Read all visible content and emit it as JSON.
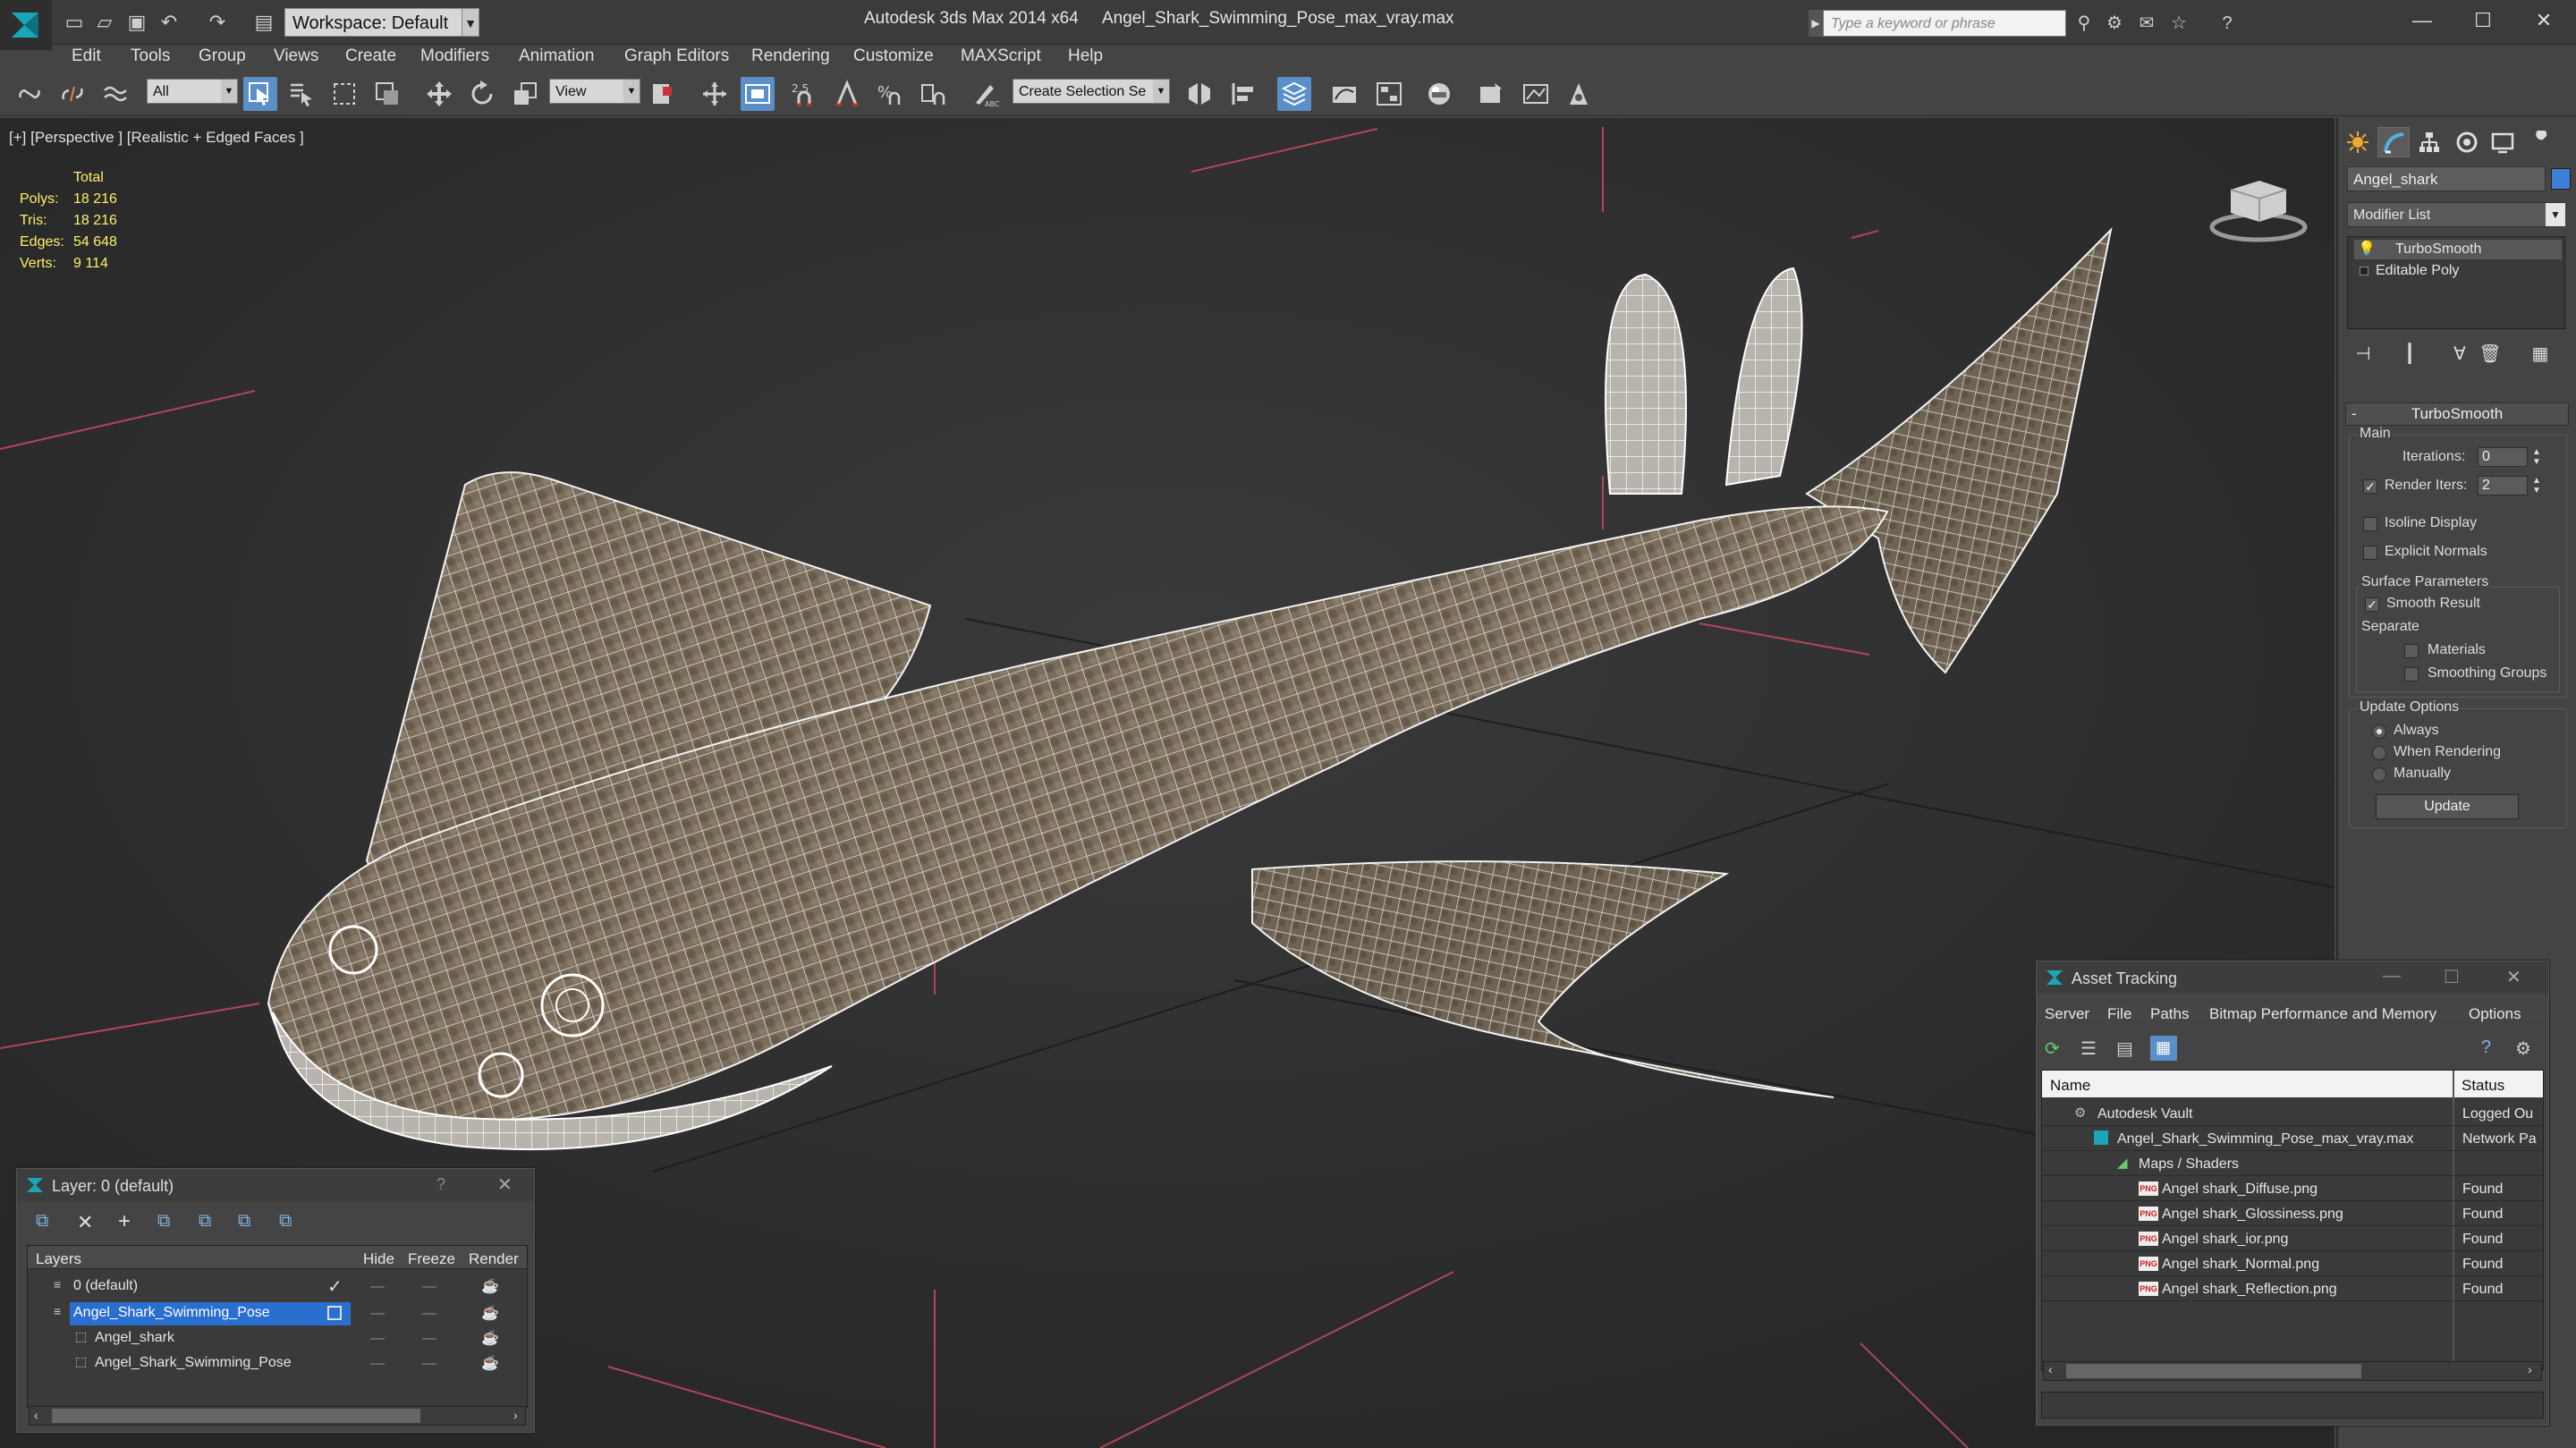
{
  "window": {
    "app_title": "Autodesk 3ds Max  2014 x64",
    "file_title": "Angel_Shark_Swimming_Pose_max_vray.max",
    "workspace": "Workspace: Default",
    "search_placeholder": "Type a keyword or phrase"
  },
  "menu": [
    "Edit",
    "Tools",
    "Group",
    "Views",
    "Create",
    "Modifiers",
    "Animation",
    "Graph Editors",
    "Rendering",
    "Customize",
    "MAXScript",
    "Help"
  ],
  "toolbar": {
    "selection_filter": "All",
    "ref_coord": "View",
    "snap_value": "2.5",
    "named_selection": "Create Selection Se"
  },
  "viewport": {
    "label": "[+] [Perspective ] [Realistic + Edged Faces ]",
    "stats_header": "Total",
    "stats": [
      {
        "label": "Polys:",
        "value": "18 216"
      },
      {
        "label": "Tris:",
        "value": "18 216"
      },
      {
        "label": "Edges:",
        "value": "54 648"
      },
      {
        "label": "Verts:",
        "value": "9 114"
      }
    ]
  },
  "command_panel": {
    "object_name": "Angel_shark",
    "object_color": "#3f7ed6",
    "modifier_list": "Modifier List",
    "stack": [
      "TurboSmooth",
      "Editable Poly"
    ],
    "rollout": "TurboSmooth",
    "main_label": "Main",
    "iterations_label": "Iterations:",
    "iterations_value": "0",
    "render_iters_label": "Render Iters:",
    "render_iters_value": "2",
    "isoline": "Isoline Display",
    "explicit_normals": "Explicit Normals",
    "surface_params": "Surface Parameters",
    "smooth_result": "Smooth Result",
    "separate": "Separate",
    "materials": "Materials",
    "smoothing_groups": "Smoothing Groups",
    "update_options": "Update Options",
    "always": "Always",
    "when_rendering": "When Rendering",
    "manually": "Manually",
    "update_button": "Update"
  },
  "layer_panel": {
    "title": "Layer: 0 (default)",
    "headers": [
      "Layers",
      "Hide",
      "Freeze",
      "Render"
    ],
    "rows": [
      "0 (default)",
      "Angel_Shark_Swimming_Pose",
      "Angel_shark",
      "Angel_Shark_Swimming_Pose"
    ]
  },
  "asset_panel": {
    "title": "Asset Tracking",
    "menu": [
      "Server",
      "File",
      "Paths",
      "Bitmap Performance and Memory",
      "Options"
    ],
    "headers": [
      "Name",
      "Status"
    ],
    "rows": [
      {
        "name": "Autodesk Vault",
        "status": "Logged Ou"
      },
      {
        "name": "Angel_Shark_Swimming_Pose_max_vray.max",
        "status": "Network Pa"
      },
      {
        "name": "Maps / Shaders",
        "status": ""
      },
      {
        "name": "Angel shark_Diffuse.png",
        "status": "Found"
      },
      {
        "name": "Angel shark_Glossiness.png",
        "status": "Found"
      },
      {
        "name": "Angel shark_ior.png",
        "status": "Found"
      },
      {
        "name": "Angel shark_Normal.png",
        "status": "Found"
      },
      {
        "name": "Angel shark_Reflection.png",
        "status": "Found"
      }
    ]
  }
}
